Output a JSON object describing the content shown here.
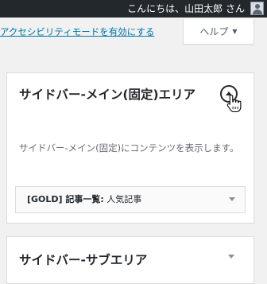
{
  "admin_bar": {
    "greeting": "こんにちは、山田太郎 さん",
    "avatar_icon": "user-avatar-icon"
  },
  "accessibility_link": "アクセシビリティモードを有効にする",
  "help_tab": {
    "label": "ヘルプ",
    "caret": "▼"
  },
  "sidebar_main": {
    "title": "サイドバー-メイン(固定)エリア",
    "toggle_icon": "chevron-up-circle-icon",
    "description": "サイドバー-メイン(固定)にコンテンツを表示します。",
    "widget": {
      "name": "[GOLD] 記事一覧:",
      "subtitle": " 人気記事"
    }
  },
  "sidebar_sub": {
    "title": "サイドバー-サブエリア"
  },
  "colors": {
    "admin_bar": "#23282d",
    "link": "#0073aa",
    "background": "#f1f1f1"
  }
}
